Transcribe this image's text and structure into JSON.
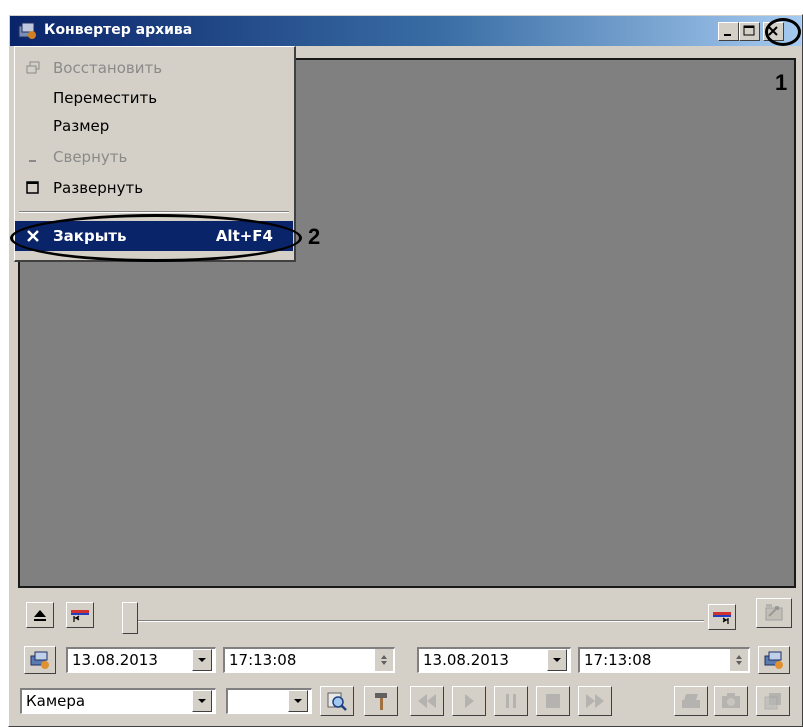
{
  "window": {
    "title": "Конвертер архива",
    "controls": [
      "minimize",
      "maximize",
      "close"
    ]
  },
  "callouts": {
    "one": "1",
    "two": "2"
  },
  "system_menu": {
    "items": [
      {
        "label": "Восстановить",
        "icon": "restore-icon",
        "enabled": false
      },
      {
        "label": "Переместить",
        "icon": "",
        "enabled": true
      },
      {
        "label": "Размер",
        "icon": "",
        "enabled": true
      },
      {
        "label": "Свернуть",
        "icon": "minimize-icon",
        "enabled": false
      },
      {
        "label": "Развернуть",
        "icon": "maximize-icon",
        "enabled": true
      },
      {
        "label": "Закрыть",
        "icon": "close-icon",
        "enabled": true,
        "shortcut": "Alt+F4",
        "highlighted": true
      }
    ]
  },
  "timeline": {
    "position": 0.0
  },
  "range": {
    "start_date": "13.08.2013",
    "start_time": "17:13:08",
    "end_date": "13.08.2013",
    "end_time": "17:13:08"
  },
  "controls": {
    "camera_select": "Камера",
    "second_select": ""
  },
  "colors": {
    "titlebar_start": "#0a246a",
    "titlebar_end": "#a6caf0",
    "video_bg": "#808080",
    "menu_highlight": "#0a246a"
  }
}
